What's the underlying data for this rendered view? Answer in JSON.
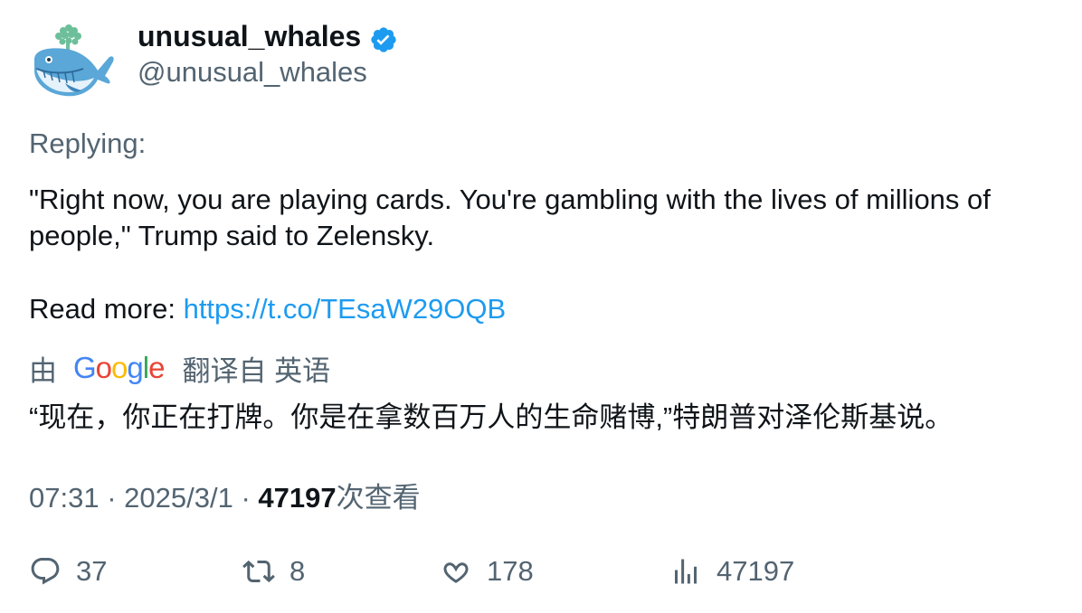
{
  "author": {
    "display_name": "unusual_whales",
    "handle": "@unusual_whales",
    "verified": true
  },
  "replying_label": "Replying:",
  "tweet": {
    "text": "\"Right now, you are playing cards. You're gambling with the lives of millions of people,\" Trump said to Zelensky.",
    "read_more_label": "Read more: ",
    "link": "https://t.co/TEsaW29OQB"
  },
  "translation": {
    "by_label": "由",
    "provider": "Google",
    "from_label": "翻译自 英语",
    "text": "“现在，你正在打牌。你是在拿数百万人的生命赌博,”特朗普对泽伦斯基说。"
  },
  "meta": {
    "time": "07:31",
    "separator": "·",
    "date": "2025/3/1",
    "views_count": "47197",
    "views_label": "次查看"
  },
  "actions": {
    "replies": "37",
    "retweets": "8",
    "likes": "178",
    "views": "47197"
  },
  "colors": {
    "link": "#1d9bf0",
    "secondary_text": "#536471",
    "verified_badge": "#1d9bf0",
    "google_blue": "#4285f4",
    "google_red": "#ea4335",
    "google_yellow": "#fbbc05",
    "google_green": "#34a853"
  },
  "icons": {
    "avatar": "whale-logo-icon",
    "verified": "verified-badge-icon",
    "reply": "reply-icon",
    "retweet": "retweet-icon",
    "like": "heart-icon",
    "views": "bar-chart-icon"
  }
}
